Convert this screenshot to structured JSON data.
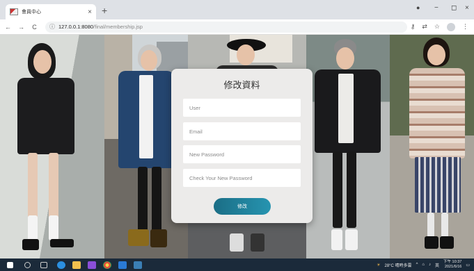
{
  "browser": {
    "tab_title": "會員中心",
    "tab_close": "×",
    "new_tab": "+",
    "win_minimize": "−",
    "win_maximize": "◻",
    "win_close": "×",
    "nav_back": "←",
    "nav_forward": "→",
    "nav_reload": "C",
    "url_host": "127.0.0.1:8080",
    "url_path": "/final/membership.jsp"
  },
  "form": {
    "title": "修改資料",
    "user_placeholder": "User",
    "email_placeholder": "Email",
    "new_password_placeholder": "New Password",
    "check_password_placeholder": "Check Your New Password",
    "submit_label": "修改",
    "button_color": "#2388a4"
  },
  "taskbar": {
    "weather": "28°C 晴時多雲",
    "ime": "英",
    "time": "下午 10:37",
    "date": "2021/6/16"
  }
}
